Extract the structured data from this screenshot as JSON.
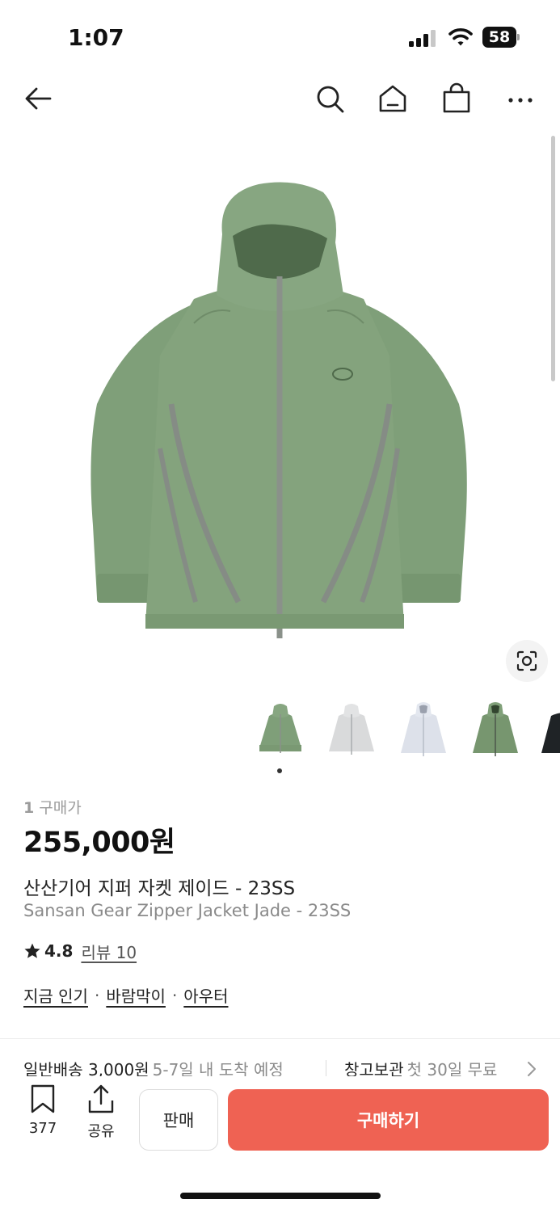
{
  "status_bar": {
    "time": "1:07",
    "battery": "58"
  },
  "nav": {
    "icons": [
      "back-arrow-icon",
      "search-icon",
      "home-icon",
      "shopping-bag-icon",
      "more-icon"
    ]
  },
  "gallery": {
    "thumbnail_count": 5,
    "active_index": 0,
    "lens_icon": "image-search-icon"
  },
  "product": {
    "price_label_count": "1",
    "price_label_text": "구매가",
    "price": "255,000원",
    "title_ko": "산산기어 지퍼 자켓 제이드 - 23SS",
    "title_en": "Sansan Gear Zipper Jacket Jade - 23SS",
    "rating": "4.8",
    "review_link": "리뷰 10",
    "tags": [
      "지금 인기",
      "바람막이",
      "아우터"
    ],
    "tag_separator": "·"
  },
  "delivery": {
    "label": "일반배송 3,000원",
    "eta": "5-7일 내 도착 예정",
    "storage_label": "창고보관",
    "storage_note": "첫 30일 무료"
  },
  "bottom_bar": {
    "save_count": "377",
    "share_label": "공유",
    "sell_label": "판매",
    "buy_label": "구매하기"
  },
  "colors": {
    "accent": "#ef6253",
    "jacket_green": "#7f9f79",
    "muted_text": "#8a8a8a"
  }
}
